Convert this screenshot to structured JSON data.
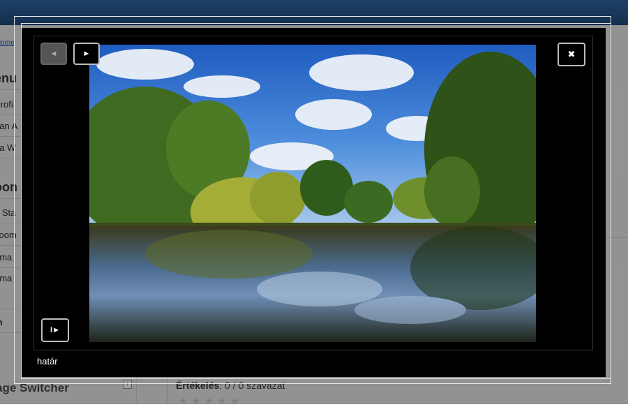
{
  "background": {
    "breadcrumb": "Home",
    "sidebar": {
      "menu_heading": "enu",
      "menu_items": [
        "Profi",
        "t an A",
        "t a W"
      ],
      "section_heading": "oon",
      "section_items": [
        "g Sta",
        "Joom",
        "oma",
        "oma"
      ],
      "partial_label": "m"
    },
    "switcher_heading": "age Switcher",
    "switcher_toggle": "+",
    "rating_label": "Értékelés",
    "rating_value": ": 0 / 0 szavazat",
    "stars": "★★★★★"
  },
  "lightbox": {
    "prev_icon": "◄",
    "next_icon": "►",
    "close_icon": "✖",
    "slideshow_icon": "I►",
    "caption": "határ"
  }
}
